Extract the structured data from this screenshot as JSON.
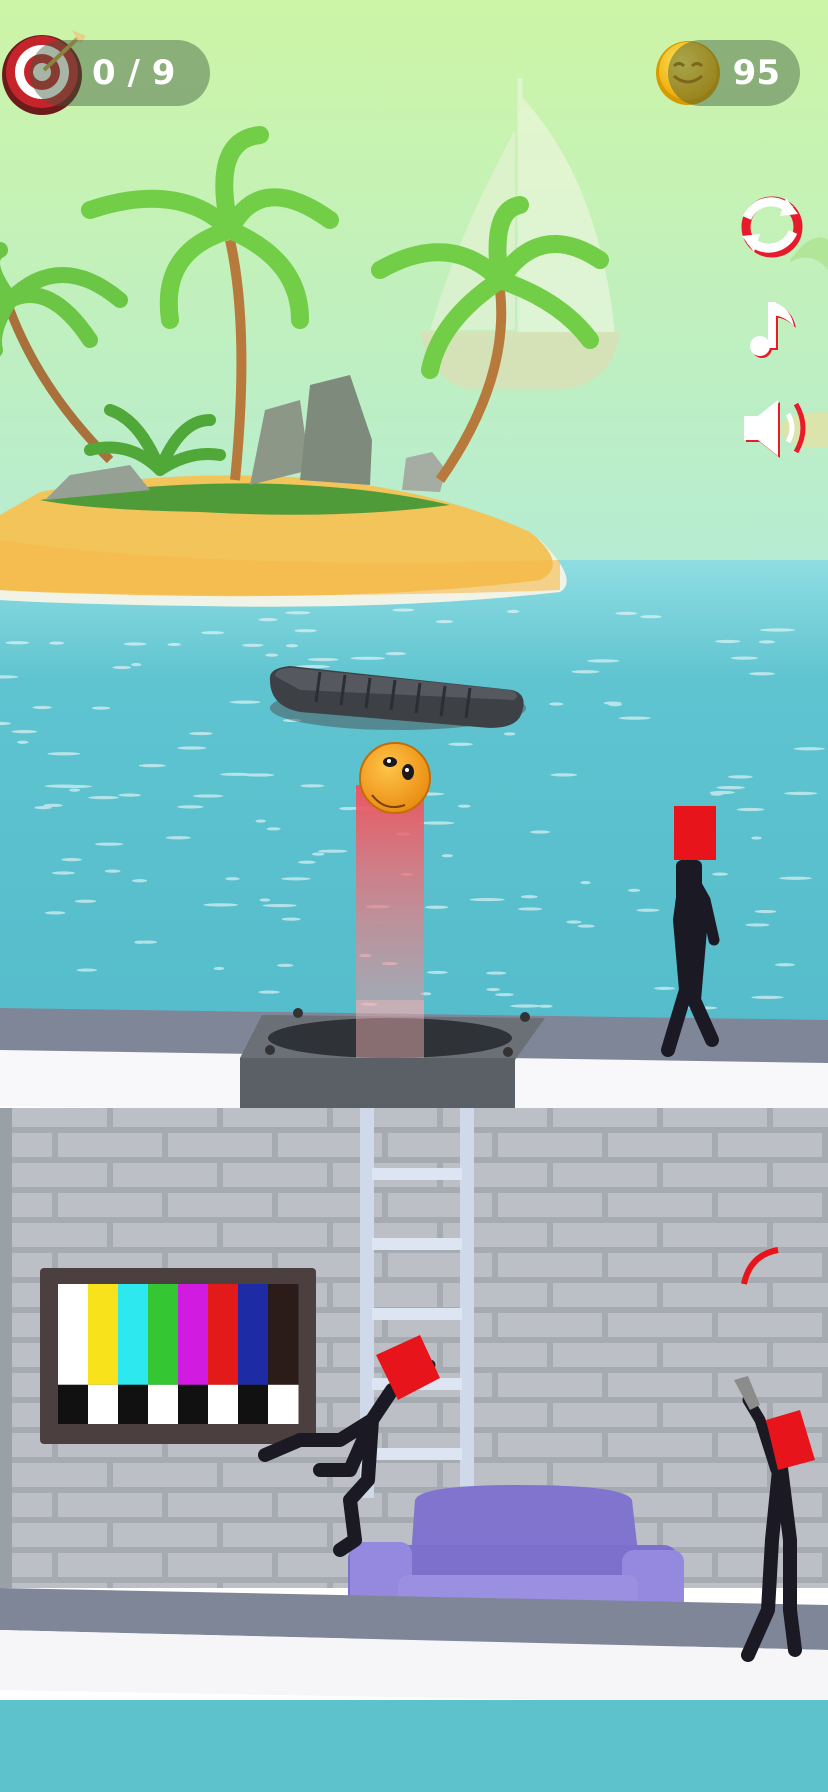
{
  "hud": {
    "targets_killed": "0 / 9",
    "coins": "95"
  },
  "icons": {
    "target": "target-icon",
    "coin": "coin-icon",
    "restart": "restart-icon",
    "music": "music-note-icon",
    "sound": "speaker-icon"
  },
  "colors": {
    "sky_top": "#cdf5a6",
    "sky_bottom": "#b6ecd2",
    "sea": "#5cc2cf",
    "enemy_head": "#e8141b",
    "ball": "#f6a21d",
    "couch": "#8b7fd6",
    "wall": "#b8bcc2"
  },
  "level": {
    "tv_bar_colors": [
      "#ffffff",
      "#f7e21b",
      "#2de8ee",
      "#34c633",
      "#d21be1",
      "#e21a1a",
      "#1d2ca4",
      "#2b1c1a"
    ]
  }
}
